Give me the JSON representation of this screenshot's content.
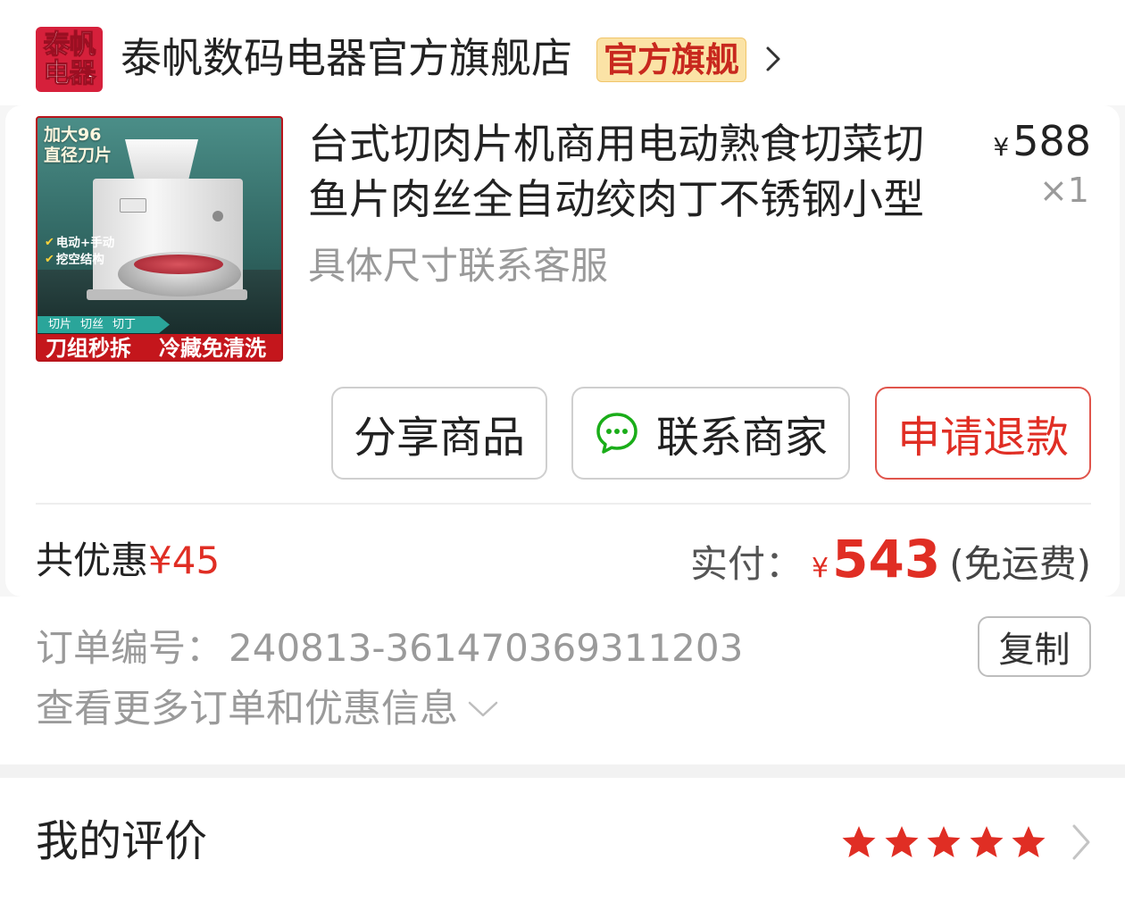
{
  "store": {
    "logo": {
      "line1": "泰帆",
      "line2": "电器"
    },
    "name": "泰帆数码电器官方旗舰店",
    "badge": "官方旗舰"
  },
  "product": {
    "image_text": {
      "size_line1": "加大96",
      "size_line2": "直径刀片",
      "features": [
        "电动+手动",
        "挖空结构"
      ],
      "modes": [
        "切片",
        "切丝",
        "切丁"
      ],
      "banner": [
        "刀组秒拆",
        "冷藏免清洗"
      ]
    },
    "title_lines": [
      "台式切肉片机商用电动熟食切菜切",
      "鱼片肉丝全自动绞肉丁不锈钢小型"
    ],
    "spec": "具体尺寸联系客服",
    "currency": "¥",
    "price": "588",
    "quantity": "×1"
  },
  "actions": {
    "share": "分享商品",
    "contact": "联系商家",
    "refund": "申请退款"
  },
  "summary": {
    "discount_label": "共优惠",
    "discount_value": "¥45",
    "paid_label": "实付：",
    "paid_currency": "¥",
    "paid_amount": "543",
    "shipping_note": "(免运费)"
  },
  "order": {
    "number_label": "订单编号：",
    "number": "240813-361470369311203",
    "copy_label": "复制",
    "more_info": "查看更多订单和优惠信息"
  },
  "review": {
    "title": "我的评价",
    "rating": 5,
    "max_rating": 5
  },
  "icons": {
    "store_chevron": "chevron-right-icon",
    "contact": "chat-bubble-icon",
    "feature_check": "check-icon",
    "more_info": "chevron-down-icon",
    "rating": "star-icon",
    "review_chevron": "chevron-right-icon"
  },
  "colors": {
    "accent_red": "#e02e24",
    "badge_bg": "#fbe3a6",
    "badge_text": "#c8281e",
    "logo_bg": "#d6203b",
    "text_primary": "#222222",
    "text_secondary": "#9a9a9a",
    "chat_green": "#1aad19",
    "star_off": "#dddddd"
  }
}
